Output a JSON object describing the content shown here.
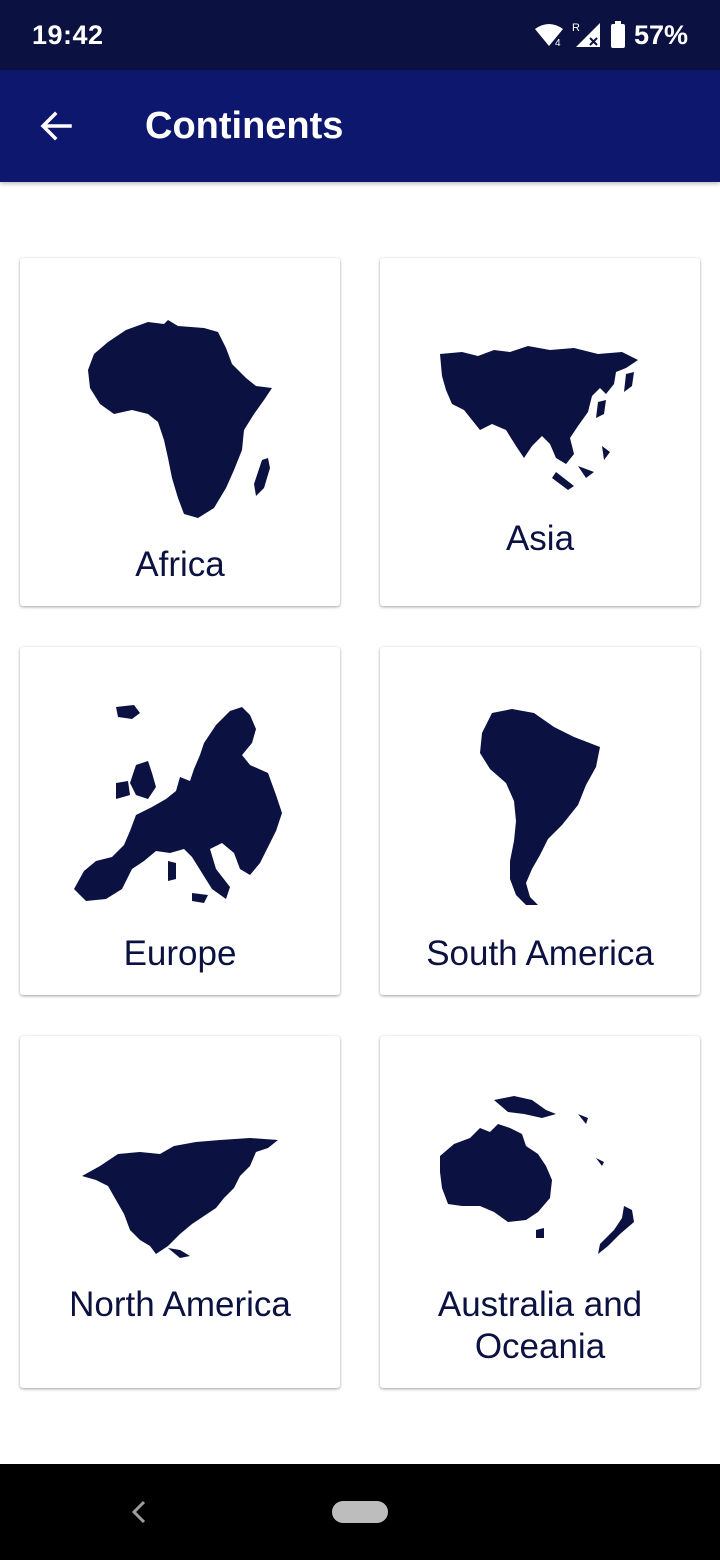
{
  "status_bar": {
    "time": "19:42",
    "battery": "57%",
    "icons": [
      "wifi-icon",
      "signal-icon",
      "battery-icon"
    ]
  },
  "app_bar": {
    "title": "Continents",
    "back_icon": "arrow-left-icon"
  },
  "continents": [
    {
      "label": "Africa",
      "icon": "africa-map-icon"
    },
    {
      "label": "Asia",
      "icon": "asia-map-icon"
    },
    {
      "label": "Europe",
      "icon": "europe-map-icon"
    },
    {
      "label": "South America",
      "icon": "south-america-map-icon"
    },
    {
      "label": "North America",
      "icon": "north-america-map-icon"
    },
    {
      "label": "Australia and Oceania",
      "icon": "australia-map-icon"
    }
  ],
  "colors": {
    "status_bar_bg": "#0b1140",
    "app_bar_bg": "#0e176e",
    "map_fill": "#0b1140",
    "label_color": "#0b1140"
  }
}
